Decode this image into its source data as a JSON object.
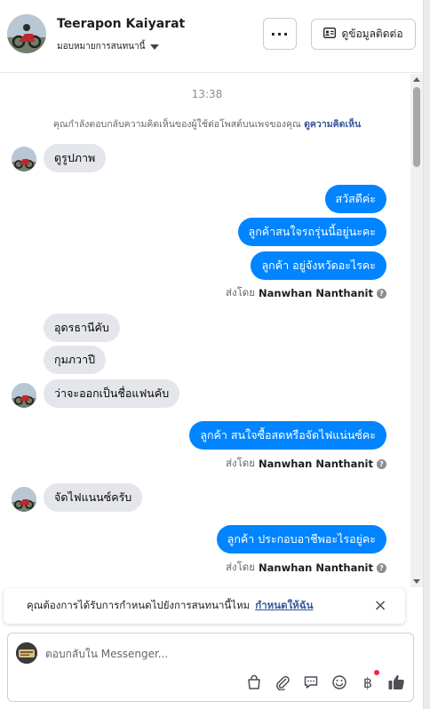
{
  "header": {
    "name": "Teerapon Kaiyarat",
    "assign_label": "มอบหมายการสนทนานี้",
    "more_label": "···",
    "contact_button_label": "ดูข้อมูลติดต่อ"
  },
  "chat": {
    "timestamp": "13:38",
    "notice_text": "คุณกำลังตอบกลับความคิดเห็นของผู้ใช้ต่อโพสต์บนเพจของคุณ",
    "notice_link": "ดูความคิดเห็น",
    "messages": [
      {
        "dir": "in",
        "text": "ดูรูปภาพ"
      },
      {
        "dir": "out",
        "text": "สวัสดีค่ะ"
      },
      {
        "dir": "out",
        "text": "ลูกค้าสนใจรถรุ่นนี้อยู่นะคะ"
      },
      {
        "dir": "out",
        "text": "ลูกค้า  อยู่จังหวัดอะไรคะ"
      },
      {
        "dir": "in",
        "text": "อุดรธานีคับ"
      },
      {
        "dir": "in",
        "text": "กุมภวาปี"
      },
      {
        "dir": "in",
        "text": "ว่าจะออกเป็นชื่อแฟนคับ"
      },
      {
        "dir": "out",
        "text": "ลูกค้า สนใจซื้อสดหรือจัดไฟแน่นซ์คะ"
      },
      {
        "dir": "in",
        "text": "จัดไฟแนนซ์ครับ"
      },
      {
        "dir": "out",
        "text": "ลูกค้า ประกอบอาชีพอะไรอยู่คะ"
      }
    ],
    "sent_by_prefix": "ส่งโดย",
    "sent_by_name": "Nanwhan Nanthanit",
    "help_mark": "?"
  },
  "banner": {
    "text": "คุณต้องการได้รับการกำหนดไปยังการสนทนานี้ไหม",
    "link": "กำหนดให้ฉัน",
    "close": "×"
  },
  "composer": {
    "placeholder": "ตอบกลับใน Messenger...",
    "baht_symbol": "฿",
    "tools": [
      "bag-icon",
      "attachment-icon",
      "chat-icon",
      "emoji-icon",
      "baht-icon",
      "thumbs-up-icon"
    ]
  },
  "colors": {
    "outgoing_bubble": "#0084ff",
    "incoming_bubble": "#e4e6eb",
    "link": "#385898",
    "badge": "#f0284a"
  }
}
